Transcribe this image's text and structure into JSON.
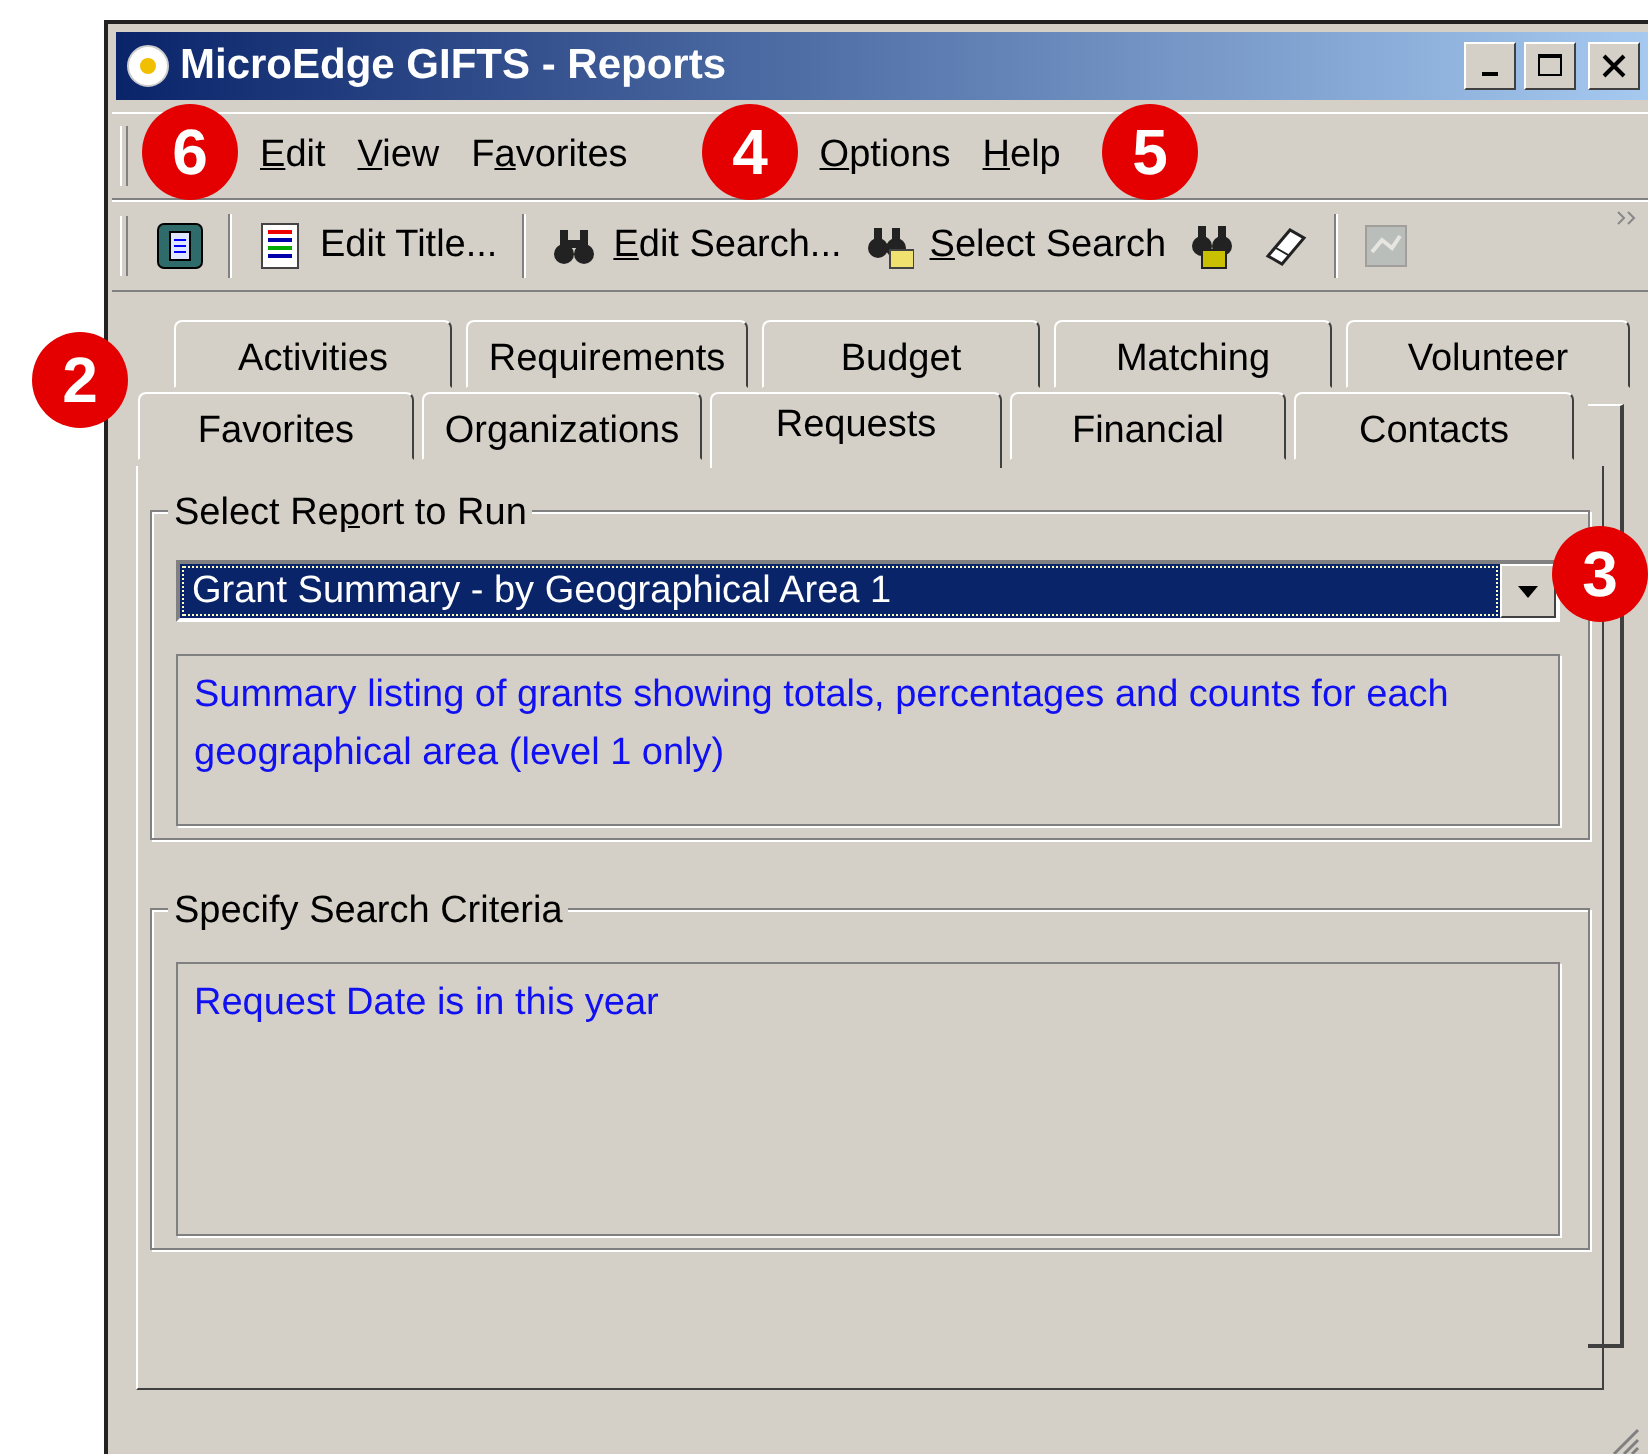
{
  "window": {
    "title": "MicroEdge GIFTS - Reports"
  },
  "menu": [
    {
      "segments": [
        {
          "t": "E",
          "underlined": true
        },
        {
          "t": "dit",
          "underlined": false
        }
      ]
    },
    {
      "segments": [
        {
          "t": "V",
          "underlined": true
        },
        {
          "t": "iew",
          "underlined": false
        }
      ]
    },
    {
      "segments": [
        {
          "t": "F",
          "underlined": false
        },
        {
          "t": "a",
          "underlined": true
        },
        {
          "t": "vorites",
          "underlined": false
        }
      ]
    },
    {
      "segments": [
        {
          "t": "O",
          "underlined": true
        },
        {
          "t": "ptions",
          "underlined": false
        }
      ]
    },
    {
      "segments": [
        {
          "t": "H",
          "underlined": true
        },
        {
          "t": "elp",
          "underlined": false
        }
      ]
    }
  ],
  "toolbar": [
    {
      "kind": "icon",
      "disabled": false
    },
    {
      "kind": "separator"
    },
    {
      "kind": "labeled",
      "disabled": false,
      "segments": [
        {
          "t": "Edit Title...",
          "underlined": false
        }
      ]
    },
    {
      "kind": "separator"
    },
    {
      "kind": "labeled",
      "disabled": false,
      "segments": [
        {
          "t": "E",
          "underlined": true
        },
        {
          "t": "dit Search...",
          "underlined": false
        }
      ]
    },
    {
      "kind": "labeled",
      "disabled": false,
      "segments": [
        {
          "t": "S",
          "underlined": true
        },
        {
          "t": "elect Search",
          "underlined": false
        }
      ]
    },
    {
      "kind": "icon",
      "disabled": false
    },
    {
      "kind": "icon",
      "disabled": false
    },
    {
      "kind": "separator"
    },
    {
      "kind": "icon",
      "disabled": true
    }
  ],
  "tabs": {
    "back_row": [
      {
        "label": "Activities",
        "selected": false
      },
      {
        "label": "Requirements",
        "selected": false
      },
      {
        "label": "Budget",
        "selected": false
      },
      {
        "label": "Matching",
        "selected": false
      },
      {
        "label": "Volunteer",
        "selected": false
      }
    ],
    "front_row": [
      {
        "label": "Favorites",
        "selected": false
      },
      {
        "label": "Organizations",
        "selected": false
      },
      {
        "label": "Requests",
        "selected": true
      },
      {
        "label": "Financial",
        "selected": false
      },
      {
        "label": "Contacts",
        "selected": false
      }
    ]
  },
  "report": {
    "legend": [
      {
        "t": "Select Re",
        "underlined": false
      },
      {
        "t": "p",
        "underlined": true
      },
      {
        "t": "ort to Run",
        "underlined": false
      }
    ],
    "value": "Grant Summary - by Geographical Area 1",
    "description": "Summary listing of grants showing totals, percentages and counts for each geographical area (level 1 only)"
  },
  "criteria": {
    "legend": [
      {
        "t": "Specify Search Criteria",
        "underlined": false
      }
    ],
    "text": "Request Date is in this year"
  },
  "callouts": [
    {
      "label": "6"
    },
    {
      "label": "4"
    },
    {
      "label": "5"
    },
    {
      "label": "2"
    },
    {
      "label": "3"
    }
  ]
}
